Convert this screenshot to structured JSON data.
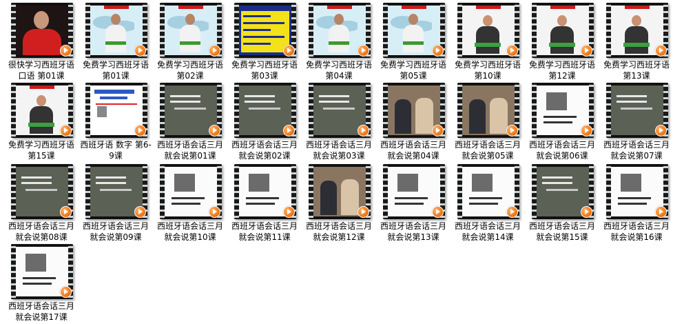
{
  "items": [
    {
      "caption": "很快学习西班牙语口语 第01课",
      "thumb": "presenter-red"
    },
    {
      "caption": "免费学习西班牙语 第01课",
      "thumb": "map-presenter"
    },
    {
      "caption": "免费学习西班牙语 第02课",
      "thumb": "map-presenter"
    },
    {
      "caption": "免费学习西班牙语 第03课",
      "thumb": "yellow-slide"
    },
    {
      "caption": "免费学习西班牙语 第04课",
      "thumb": "map-presenter"
    },
    {
      "caption": "免费学习西班牙语 第05课",
      "thumb": "map-presenter"
    },
    {
      "caption": "免费学习西班牙语 第10课",
      "thumb": "white-presenter"
    },
    {
      "caption": "免费学习西班牙语 第12课",
      "thumb": "white-presenter"
    },
    {
      "caption": "免费学习西班牙语 第13课",
      "thumb": "white-presenter"
    },
    {
      "caption": "免费学习西班牙语 第15课",
      "thumb": "white-presenter"
    },
    {
      "caption": "西班牙语 数字 第6-9课",
      "thumb": "white-slide"
    },
    {
      "caption": "西班牙语会话三月就会说第01课",
      "thumb": "chalkboard"
    },
    {
      "caption": "西班牙语会话三月就会说第02课",
      "thumb": "chalkboard"
    },
    {
      "caption": "西班牙语会话三月就会说第03课",
      "thumb": "chalkboard"
    },
    {
      "caption": "西班牙语会话三月就会说第04课",
      "thumb": "photo-scene"
    },
    {
      "caption": "西班牙语会话三月就会说第05课",
      "thumb": "photo-scene"
    },
    {
      "caption": "西班牙语会话三月就会说第06课",
      "thumb": "lesson-card"
    },
    {
      "caption": "西班牙语会话三月就会说第07课",
      "thumb": "chalkboard"
    },
    {
      "caption": "西班牙语会话三月就会说第08课",
      "thumb": "chalkboard"
    },
    {
      "caption": "西班牙语会话三月就会说第09课",
      "thumb": "chalkboard"
    },
    {
      "caption": "西班牙语会话三月就会说第10课",
      "thumb": "lesson-card"
    },
    {
      "caption": "西班牙语会话三月就会说第11课",
      "thumb": "lesson-card"
    },
    {
      "caption": "西班牙语会话三月就会说第12课",
      "thumb": "photo-scene"
    },
    {
      "caption": "西班牙语会话三月就会说第13课",
      "thumb": "lesson-card"
    },
    {
      "caption": "西班牙语会话三月就会说第14课",
      "thumb": "lesson-card"
    },
    {
      "caption": "西班牙语会话三月就会说第15课",
      "thumb": "chalkboard"
    },
    {
      "caption": "西班牙语会话三月就会说第16课",
      "thumb": "lesson-card"
    },
    {
      "caption": "西班牙语会话三月就会说第17课",
      "thumb": "lesson-card"
    }
  ]
}
